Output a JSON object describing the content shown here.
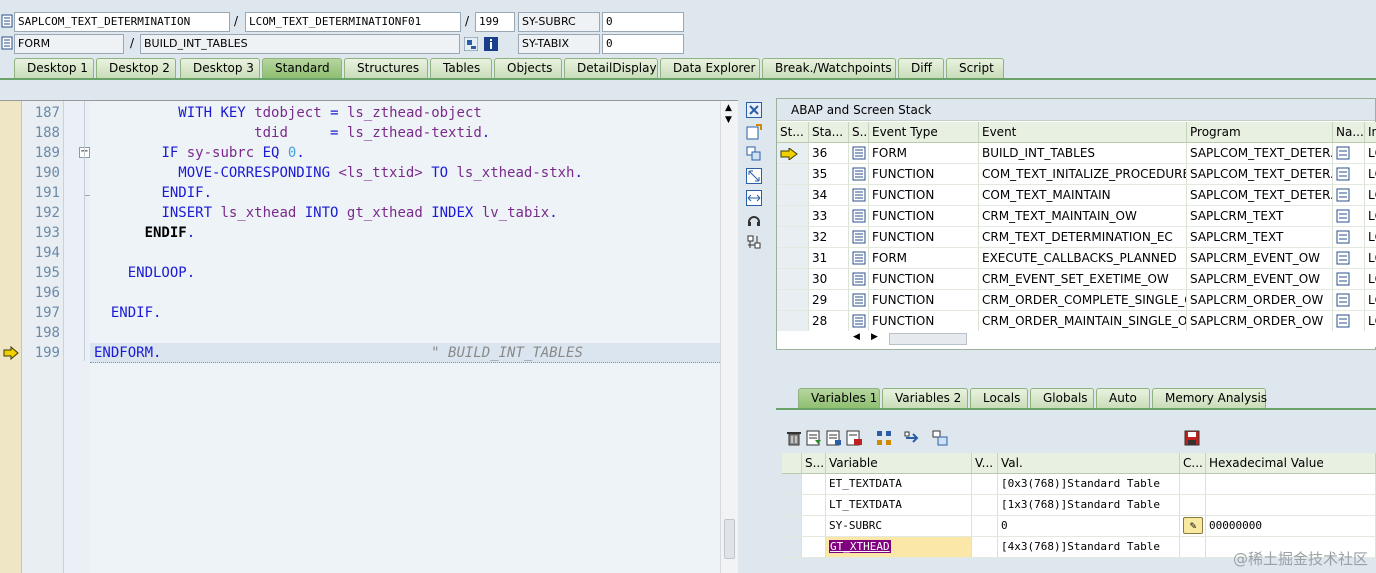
{
  "header": {
    "program": "SAPLCOM_TEXT_DETERMINATION",
    "include": "LCOM_TEXT_DETERMINATIONF01",
    "line": "199",
    "sy_subrc_label": "SY-SUBRC",
    "sy_subrc_value": "0",
    "event_type": "FORM",
    "event": "BUILD_INT_TABLES",
    "sy_tabix_label": "SY-TABIX",
    "sy_tabix_value": "0"
  },
  "tabs": [
    "Desktop 1",
    "Desktop 2",
    "Desktop 3",
    "Standard",
    "Structures",
    "Tables",
    "Objects",
    "DetailDisplay",
    "Data Explorer",
    "Break./Watchpoints",
    "Diff",
    "Script"
  ],
  "active_tab": "Standard",
  "code": {
    "lines": [
      {
        "n": "187",
        "t": "          WITH KEY tdobject = ls_zthead-object"
      },
      {
        "n": "188",
        "t": "                   tdid     = ls_zthead-textid."
      },
      {
        "n": "189",
        "t": "        IF sy-subrc EQ 0."
      },
      {
        "n": "190",
        "t": "          MOVE-CORRESPONDING <ls_ttxid> TO ls_xthead-stxh."
      },
      {
        "n": "191",
        "t": "        ENDIF."
      },
      {
        "n": "192",
        "t": "        INSERT ls_xthead INTO gt_xthead INDEX lv_tabix."
      },
      {
        "n": "193",
        "t": "      ENDIF."
      },
      {
        "n": "194",
        "t": ""
      },
      {
        "n": "195",
        "t": "    ENDLOOP."
      },
      {
        "n": "196",
        "t": ""
      },
      {
        "n": "197",
        "t": "  ENDIF."
      },
      {
        "n": "198",
        "t": ""
      },
      {
        "n": "199",
        "t": "ENDFORM.                                \" BUILD_INT_TABLES"
      }
    ]
  },
  "stack": {
    "title": "ABAP and Screen Stack",
    "columns": [
      "St...",
      "Sta...",
      "S...",
      "Event Type",
      "Event",
      "Program",
      "Na...",
      "In"
    ],
    "rows": [
      {
        "level": "36",
        "type": "FORM",
        "event": "BUILD_INT_TABLES",
        "program": "SAPLCOM_TEXT_DETER...",
        "last": "LC",
        "current": true
      },
      {
        "level": "35",
        "type": "FUNCTION",
        "event": "COM_TEXT_INITALIZE_PROCEDURE",
        "program": "SAPLCOM_TEXT_DETER...",
        "last": "LC"
      },
      {
        "level": "34",
        "type": "FUNCTION",
        "event": "COM_TEXT_MAINTAIN",
        "program": "SAPLCOM_TEXT_DETER...",
        "last": "LC"
      },
      {
        "level": "33",
        "type": "FUNCTION",
        "event": "CRM_TEXT_MAINTAIN_OW",
        "program": "SAPLCRM_TEXT",
        "last": "LC"
      },
      {
        "level": "32",
        "type": "FUNCTION",
        "event": "CRM_TEXT_DETERMINATION_EC",
        "program": "SAPLCRM_TEXT",
        "last": "LC"
      },
      {
        "level": "31",
        "type": "FORM",
        "event": "EXECUTE_CALLBACKS_PLANNED",
        "program": "SAPLCRM_EVENT_OW",
        "last": "LC"
      },
      {
        "level": "30",
        "type": "FUNCTION",
        "event": "CRM_EVENT_SET_EXETIME_OW",
        "program": "SAPLCRM_EVENT_OW",
        "last": "LC"
      },
      {
        "level": "29",
        "type": "FUNCTION",
        "event": "CRM_ORDER_COMPLETE_SINGLE_O...",
        "program": "SAPLCRM_ORDER_OW",
        "last": "LC"
      },
      {
        "level": "28",
        "type": "FUNCTION",
        "event": "CRM_ORDER_MAINTAIN_SINGLE_OW",
        "program": "SAPLCRM_ORDER_OW",
        "last": "LC"
      }
    ]
  },
  "vartabs": [
    "Variables 1",
    "Variables 2",
    "Locals",
    "Globals",
    "Auto",
    "Memory Analysis"
  ],
  "vars": {
    "columns": [
      "S...",
      "Variable",
      "V...",
      "Val.",
      "C...",
      "Hexadecimal Value"
    ],
    "rows": [
      {
        "name": "ET_TEXTDATA",
        "val": "[0x3(768)]Standard Table",
        "hex": ""
      },
      {
        "name": "LT_TEXTDATA",
        "val": "[1x3(768)]Standard Table",
        "hex": ""
      },
      {
        "name": "SY-SUBRC",
        "val": "0",
        "hex": "00000000"
      },
      {
        "name": "GT_XTHEAD",
        "val": "[4x3(768)]Standard Table",
        "hex": ""
      }
    ]
  },
  "watermark": "@稀土掘金技术社区",
  "colors": {
    "accent_green": "#6aa36a",
    "keyword": "#1a1ad6",
    "variable": "#7a2a8a",
    "highlight": "#800080"
  }
}
